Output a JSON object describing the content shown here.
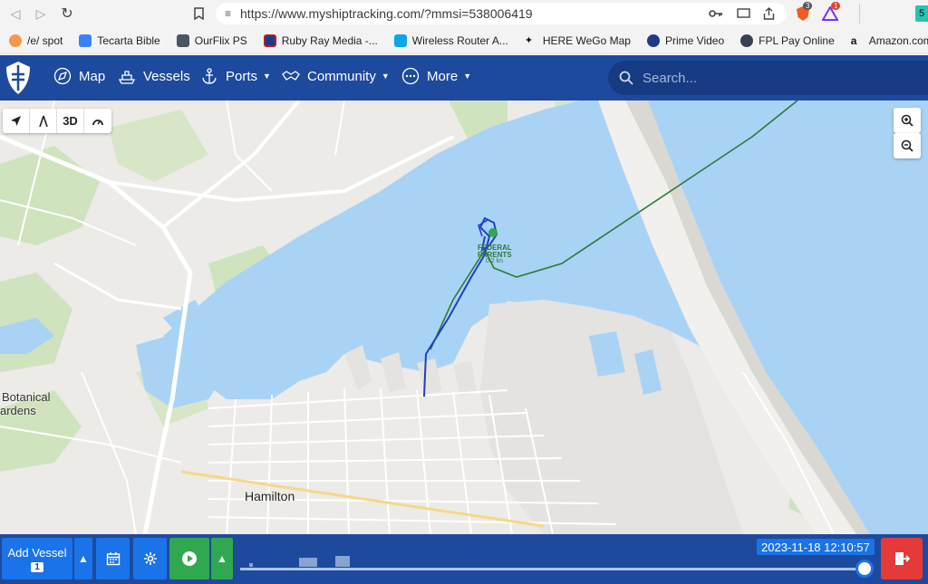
{
  "browser": {
    "url": "https://www.myshiptracking.com/?mmsi=538006419",
    "brave_badge": "3",
    "alert_badge": "1",
    "edge_label": "5"
  },
  "bookmarks": [
    {
      "label": "/e/ spot",
      "color": "#f2994a"
    },
    {
      "label": "Tecarta Bible",
      "color": "#3b82f6"
    },
    {
      "label": "OurFlix PS",
      "color": "#4b5563"
    },
    {
      "label": "Ruby Ray Media -...",
      "color": "#b91c1c"
    },
    {
      "label": "Wireless Router A...",
      "color": "#0ea5e9"
    },
    {
      "label": "HERE WeGo Map",
      "color": "#111827"
    },
    {
      "label": "Prime Video",
      "color": "#1e3a8a"
    },
    {
      "label": "FPL Pay Online",
      "color": "#374151"
    },
    {
      "label": "Amazon.com: Pri...",
      "color": "#111111"
    }
  ],
  "header": {
    "menu": [
      {
        "label": "Map",
        "caret": false
      },
      {
        "label": "Vessels",
        "caret": false
      },
      {
        "label": "Ports",
        "caret": true
      },
      {
        "label": "Community",
        "caret": true
      },
      {
        "label": "More",
        "caret": true
      }
    ],
    "search_placeholder": "Search..."
  },
  "map": {
    "tools": [
      "3D"
    ],
    "labels": {
      "botanical": "Botanical",
      "gardens": "ardens",
      "city": "Hamilton"
    },
    "vessel": {
      "name_line1": "FEDERAL",
      "name_line2": "PARENTS",
      "speed": "0.2 kn"
    }
  },
  "bottom": {
    "add_vessel": "Add Vessel",
    "vessel_count": "1",
    "timestamp": "2023-11-18 12:10:57",
    "playback_position": 1.0
  },
  "colors": {
    "header": "#1e4a9e",
    "water": "#a9d3f5",
    "track_blue": "#1f3fc7",
    "track_green": "#2a7a3a"
  }
}
